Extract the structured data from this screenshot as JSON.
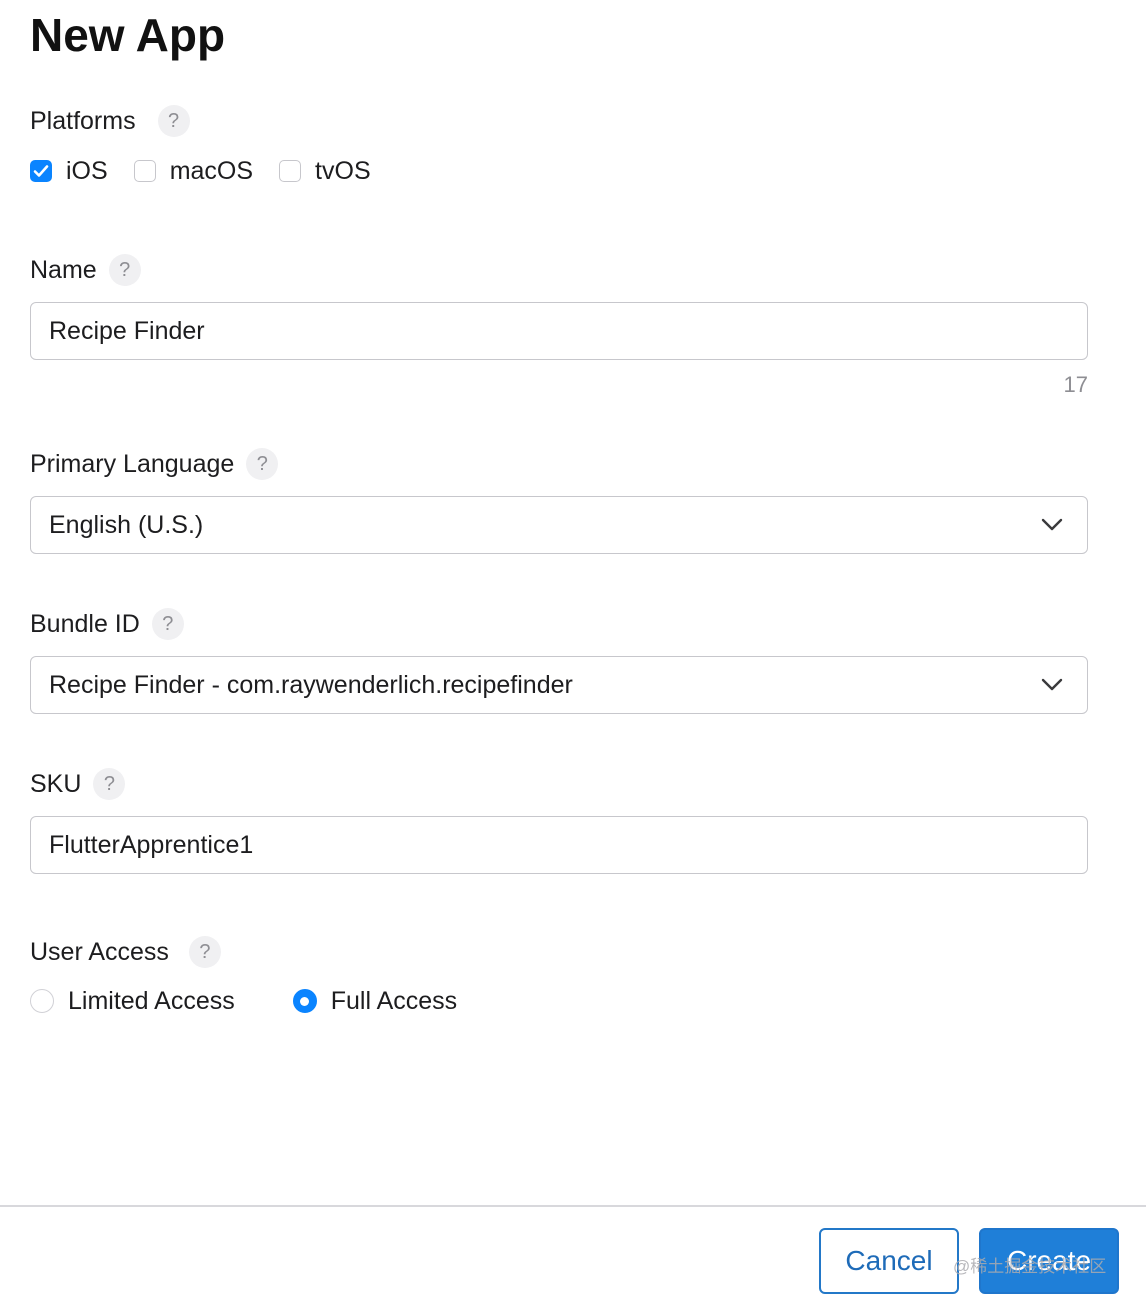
{
  "page": {
    "title": "New App"
  },
  "help_glyph": "?",
  "platforms": {
    "label": "Platforms",
    "options": [
      {
        "label": "iOS",
        "checked": true
      },
      {
        "label": "macOS",
        "checked": false
      },
      {
        "label": "tvOS",
        "checked": false
      }
    ]
  },
  "name": {
    "label": "Name",
    "value": "Recipe Finder",
    "remaining_count": "17"
  },
  "primary_language": {
    "label": "Primary Language",
    "selected": "English (U.S.)"
  },
  "bundle_id": {
    "label": "Bundle ID",
    "selected": "Recipe Finder - com.raywenderlich.recipefinder"
  },
  "sku": {
    "label": "SKU",
    "value": "FlutterApprentice1"
  },
  "user_access": {
    "label": "User Access",
    "options": [
      {
        "label": "Limited Access",
        "selected": false
      },
      {
        "label": "Full Access",
        "selected": true
      }
    ]
  },
  "footer": {
    "cancel_label": "Cancel",
    "create_label": "Create"
  },
  "watermark": "@稀土掘金技术社区",
  "colors": {
    "accent": "#0a84ff",
    "button_blue": "#1f7fd8",
    "border": "#c7c7cc"
  },
  "icons": {
    "help": "question-mark-icon",
    "chevron": "chevron-down-icon",
    "check": "checkmark-icon"
  }
}
